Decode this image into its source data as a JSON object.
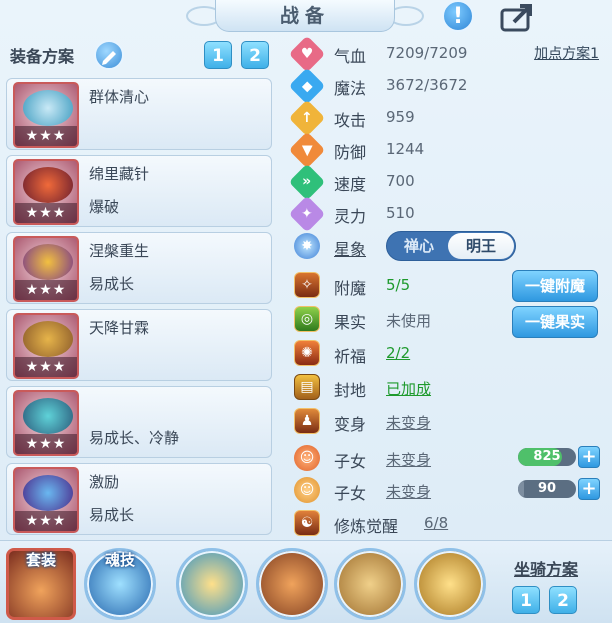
{
  "header": {
    "title": "战备"
  },
  "scheme": {
    "label": "装备方案",
    "buttons": [
      "1",
      "2"
    ]
  },
  "equipment": [
    {
      "line1": "群体清心",
      "line2": "",
      "stars": "★★★"
    },
    {
      "line1": "绵里藏针",
      "line2": "爆破",
      "stars": "★★★"
    },
    {
      "line1": "涅槃重生",
      "line2": "易成长",
      "stars": "★★★"
    },
    {
      "line1": "天降甘霖",
      "line2": "",
      "stars": "★★★"
    },
    {
      "line1": "",
      "line2": "易成长、冷静",
      "stars": "★★★"
    },
    {
      "line1": "激励",
      "line2": "易成长",
      "stars": "★★★"
    }
  ],
  "stats": [
    {
      "label": "气血",
      "value": "7209/7209",
      "icon": "heart-icon",
      "color": "#e86a86"
    },
    {
      "label": "魔法",
      "value": "3672/3672",
      "icon": "mana-icon",
      "color": "#3aa9f0"
    },
    {
      "label": "攻击",
      "value": "959",
      "icon": "attack-icon",
      "color": "#f0b43a"
    },
    {
      "label": "防御",
      "value": "1244",
      "icon": "defense-icon",
      "color": "#f08a3a"
    },
    {
      "label": "速度",
      "value": "700",
      "icon": "speed-icon",
      "color": "#2fc07a"
    },
    {
      "label": "灵力",
      "value": "510",
      "icon": "spirit-icon",
      "color": "#b989e6"
    }
  ],
  "points_scheme": "加点方案1",
  "star_sign": {
    "label": "星象",
    "option_off": "禅心",
    "option_on": "明王"
  },
  "status_rows": [
    {
      "label": "附魔",
      "value": "5/5",
      "style": "green"
    },
    {
      "label": "果实",
      "value": "未使用",
      "style": "plain"
    },
    {
      "label": "祈福",
      "value": "2/2",
      "style": "green-underline"
    },
    {
      "label": "封地",
      "value": "已加成",
      "style": "green-underline"
    },
    {
      "label": "变身",
      "value": "未变身",
      "style": "underline"
    },
    {
      "label": "子女",
      "value": "未变身",
      "style": "underline"
    },
    {
      "label": "子女",
      "value": "未变身",
      "style": "underline"
    },
    {
      "label": "修炼觉醒",
      "value": "6/8",
      "style": "underline"
    }
  ],
  "buttons": {
    "enchant": "一键附魔",
    "fruit": "一键果实"
  },
  "bars": [
    {
      "value": "825",
      "fill": 0.75,
      "color": "#4fc06a"
    },
    {
      "value": "90",
      "fill": 0.1,
      "color": "#7d8ea0"
    }
  ],
  "bottom": {
    "suit_label": "套装",
    "soul_skill_label": "魂技",
    "mount_label": "坐骑方案",
    "mount_buttons": [
      "1",
      "2"
    ]
  }
}
